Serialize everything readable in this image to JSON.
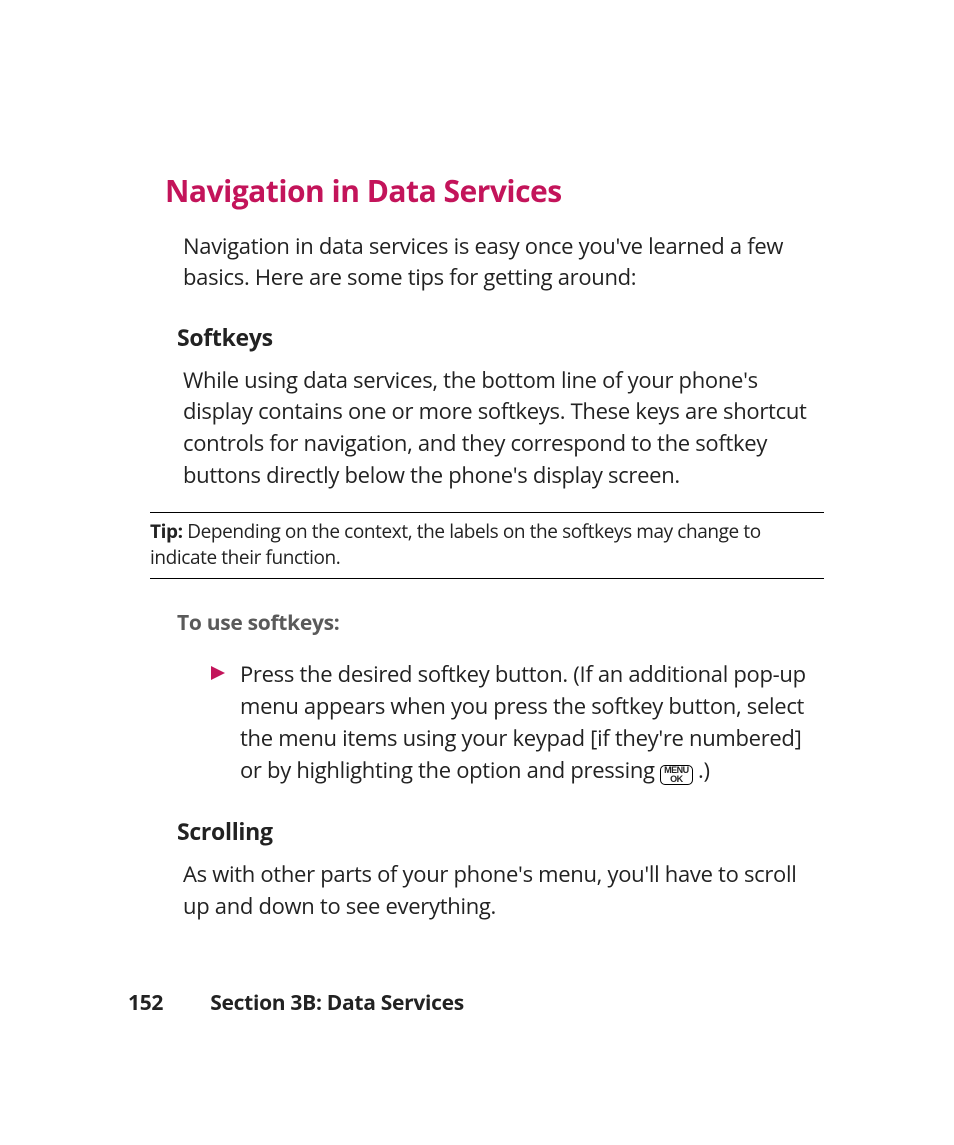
{
  "title": "Navigation in Data Services",
  "intro": "Navigation in data services is easy once you've learned a few basics. Here are some tips for getting around:",
  "softkeys": {
    "heading": "Softkeys",
    "body": "While using data services, the bottom line of your phone's display contains one or more softkeys. These keys are shortcut controls for navigation, and they correspond to the softkey buttons directly below the phone's display screen."
  },
  "tip": {
    "label": "Tip:",
    "body": " Depending on the context, the labels on the softkeys may change to indicate their function."
  },
  "instruction_heading": "To use softkeys:",
  "bullet": {
    "text_before_icon": "Press the desired softkey button. (If an additional pop-up menu appears when you press the softkey button, select the menu items using your keypad [if they're numbered] or by highlighting the option and pressing ",
    "key_line1": "MENU",
    "key_line2": "OK",
    "text_after_icon": " .)"
  },
  "scrolling": {
    "heading": "Scrolling",
    "body": "As with other parts of your phone's menu, you'll have to scroll up and down to see everything."
  },
  "footer": {
    "page_number": "152",
    "section": "Section 3B: Data Services"
  },
  "colors": {
    "accent": "#c3145a"
  }
}
